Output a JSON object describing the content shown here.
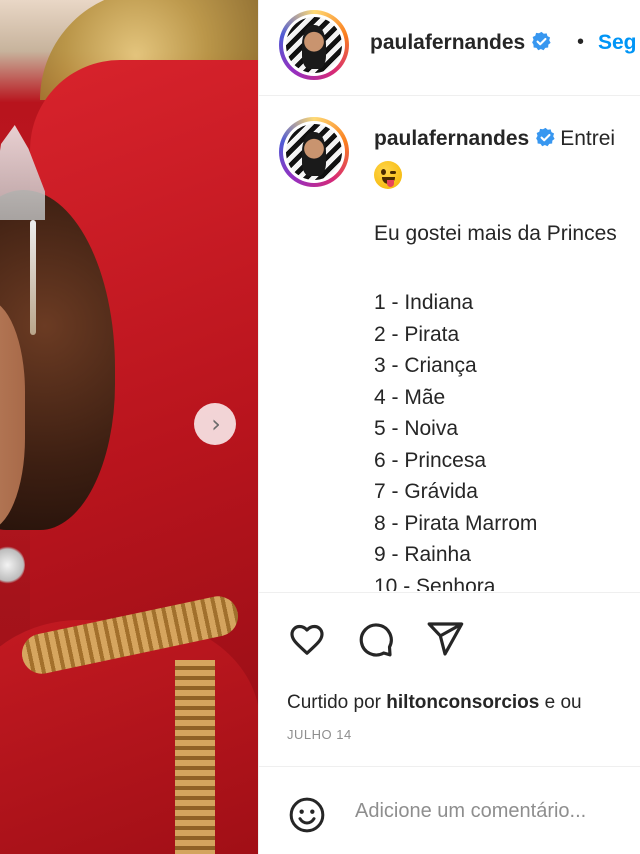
{
  "post": {
    "username": "paulafernandes",
    "separator": "•",
    "follow_label": "Seg",
    "caption_after_name": "Entrei",
    "caption_line": "Eu gostei mais da Princes",
    "list": [
      "1 - Indiana",
      "2 - Pirata",
      "3 - Criança",
      "4 - Mãe",
      "5 - Noiva",
      "6 - Princesa",
      "7 - Grávida",
      "8 - Pirata Marrom",
      "9 - Rainha",
      "10 - Senhora"
    ]
  },
  "actions": {
    "like_icon": "heart-icon",
    "comment_icon": "comment-icon",
    "share_icon": "paper-plane-icon"
  },
  "likes": {
    "prefix": "Curtido por",
    "user": "hiltonconsorcios",
    "suffix": "e ou"
  },
  "date": "JULHO 14",
  "comment": {
    "placeholder": "Adicione um comentário..."
  },
  "colors": {
    "link": "#0095f6",
    "verified": "#3897f0",
    "muted": "#8e8e8e"
  }
}
